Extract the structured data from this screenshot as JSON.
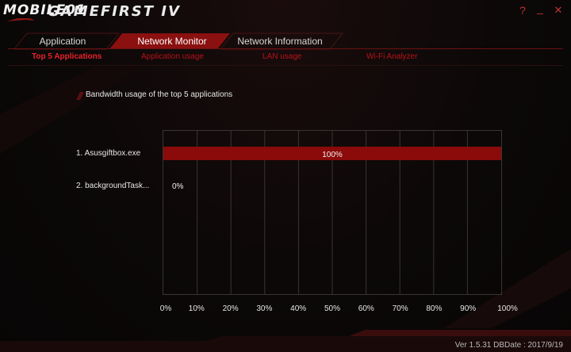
{
  "window": {
    "logo_text": "MOBILE01",
    "app_name": "GAMEFIRST IV",
    "help_glyph": "?",
    "minimize_glyph": "_",
    "close_glyph": "✕"
  },
  "tabs": [
    {
      "label": "Application",
      "active": false
    },
    {
      "label": "Network Monitor",
      "active": true
    },
    {
      "label": "Network Information",
      "active": false
    }
  ],
  "subtabs": [
    {
      "label": "Top 5 Applications",
      "active": true
    },
    {
      "label": "Application usage",
      "active": false
    },
    {
      "label": "LAN usage",
      "active": false
    },
    {
      "label": "Wi-Fi Analyzer",
      "active": false
    }
  ],
  "section": {
    "title": "Bandwidth usage of the top 5 applications"
  },
  "chart_data": {
    "type": "bar",
    "orientation": "horizontal",
    "categories": [
      "1. Asusgiftbox.exe",
      "2. backgroundTask..."
    ],
    "values": [
      100,
      0
    ],
    "value_labels": [
      "100%",
      "0%"
    ],
    "xlim": [
      0,
      100
    ],
    "x_ticks": [
      "0%",
      "10%",
      "20%",
      "30%",
      "40%",
      "50%",
      "60%",
      "70%",
      "80%",
      "90%",
      "100%"
    ],
    "grid": true,
    "bar_color": "#8b0a0a"
  },
  "footer": {
    "version": "Ver 1.5.31   DBDate : 2017/9/19"
  },
  "colors": {
    "accent": "#c0332f",
    "active_tab": "#8b1010"
  }
}
